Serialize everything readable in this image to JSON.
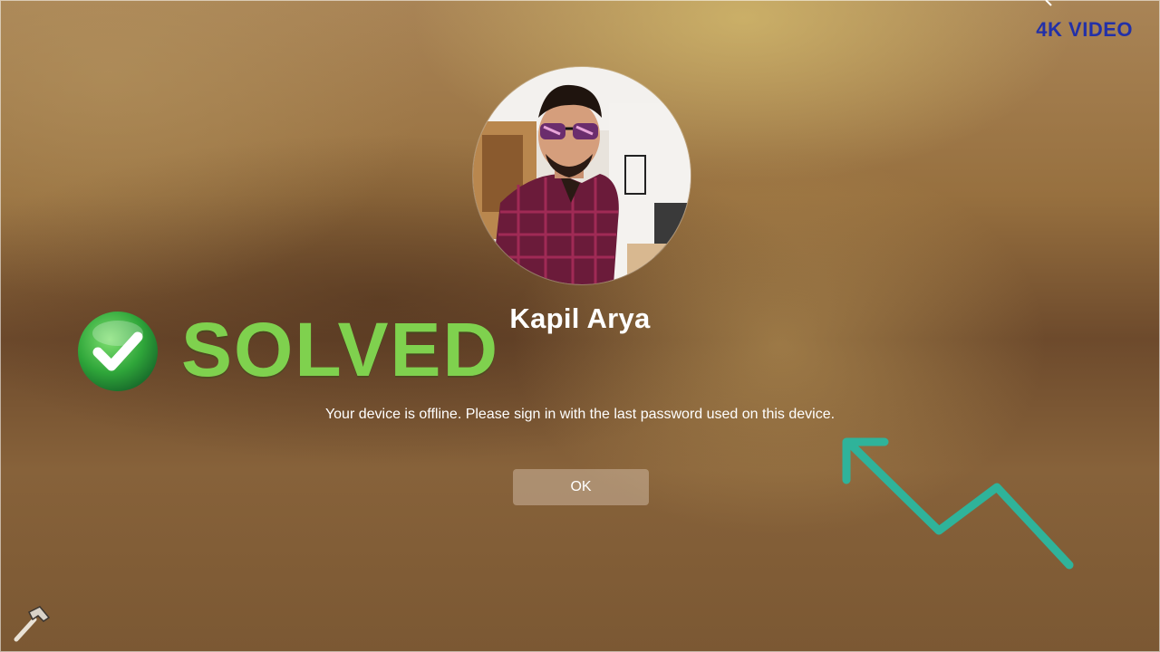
{
  "watermark": {
    "label": "4K VIDEO",
    "color": "#2230a8"
  },
  "user": {
    "name": "Kapil Arya",
    "avatar_icon": "user-photo"
  },
  "overlay": {
    "solved_label": "SOLVED",
    "solved_color": "#7fd14e",
    "check_icon": "check-circle-icon"
  },
  "dialog": {
    "message": "Your device is offline. Please sign in with the last password used on this device.",
    "ok_label": "OK"
  },
  "decor": {
    "arrow_icon": "arrow-up-left-icon",
    "arrow_color": "#2fb39a",
    "tool_icon": "hammer-icon"
  }
}
